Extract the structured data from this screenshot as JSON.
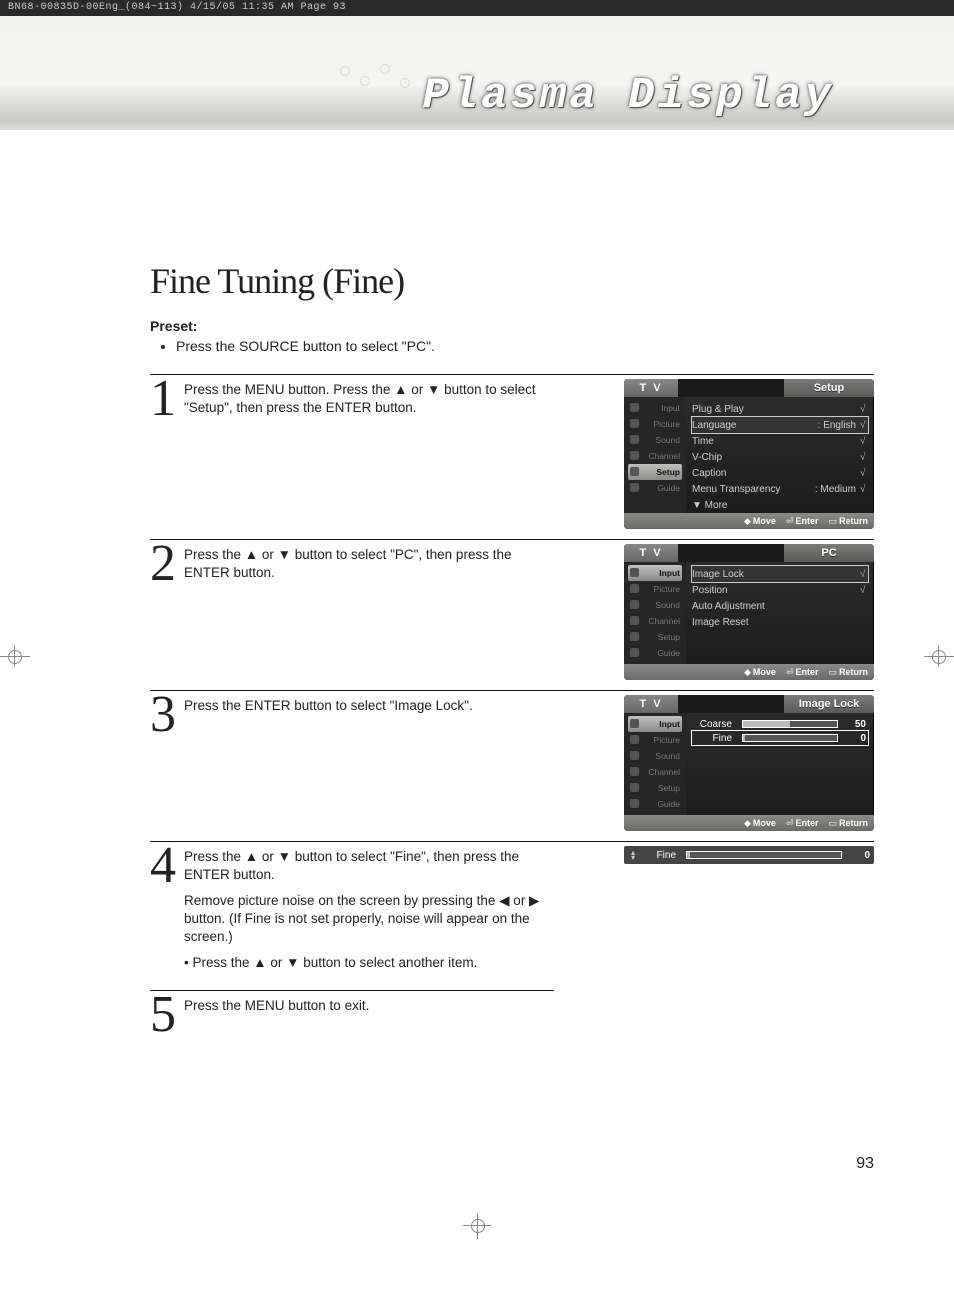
{
  "header_strip": "BN68-00835D-00Eng_(084~113)  4/15/05  11:35 AM  Page 93",
  "banner_title": "Plasma Display",
  "section_title": "Fine Tuning (Fine)",
  "preset_label": "Preset:",
  "preset_text": "Press the SOURCE button to select \"PC\".",
  "sidebar_items": [
    "Input",
    "Picture",
    "Sound",
    "Channel",
    "Setup",
    "Guide"
  ],
  "footer": {
    "move": "Move",
    "enter": "Enter",
    "return": "Return"
  },
  "steps": [
    {
      "num": "1",
      "text": "Press the MENU button. Press the ▲ or ▼ button to select \"Setup\", then press the ENTER button."
    },
    {
      "num": "2",
      "text": "Press the ▲ or ▼ button to select \"PC\", then press the ENTER button."
    },
    {
      "num": "3",
      "text": "Press the ENTER button to select \"Image Lock\"."
    },
    {
      "num": "4",
      "text": "Press the ▲ or ▼ button to select \"Fine\", then press the ENTER button.",
      "text2": "Remove picture noise on the screen by pressing the ◀ or ▶ button. (If Fine is not set properly, noise  will appear on the screen.)",
      "bullet": "Press the ▲ or ▼ button to select another item."
    },
    {
      "num": "5",
      "text": "Press the MENU button to exit."
    }
  ],
  "osd1": {
    "tv": "T V",
    "title": "Setup",
    "rows": [
      {
        "label": "Plug & Play",
        "val": "",
        "arr": "√"
      },
      {
        "label": "Language",
        "val": ": English",
        "arr": "√",
        "sel": true
      },
      {
        "label": "Time",
        "val": "",
        "arr": "√"
      },
      {
        "label": "V-Chip",
        "val": "",
        "arr": "√"
      },
      {
        "label": "Caption",
        "val": "",
        "arr": "√"
      },
      {
        "label": "Menu Transparency",
        "val": ": Medium",
        "arr": "√"
      },
      {
        "label": "▼ More",
        "val": "",
        "arr": ""
      }
    ]
  },
  "osd2": {
    "tv": "T V",
    "title": "PC",
    "rows": [
      {
        "label": "Image Lock",
        "val": "",
        "arr": "√",
        "sel": true
      },
      {
        "label": "Position",
        "val": "",
        "arr": "√"
      },
      {
        "label": "Auto Adjustment",
        "val": "",
        "arr": ""
      },
      {
        "label": "Image Reset",
        "val": "",
        "arr": ""
      }
    ]
  },
  "osd3": {
    "tv": "T V",
    "title": "Image Lock",
    "sliders": [
      {
        "label": "Coarse",
        "val": "50",
        "pct": 50
      },
      {
        "label": "Fine",
        "val": "0",
        "pct": 2,
        "sel": true
      }
    ]
  },
  "osd4": {
    "label": "Fine",
    "val": "0",
    "pct": 2
  },
  "page_num": "93"
}
